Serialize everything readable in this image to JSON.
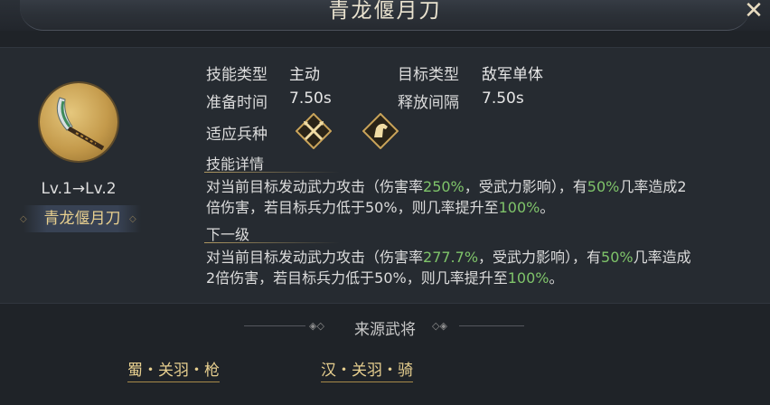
{
  "title": "青龙偃月刀",
  "close_icon": "close-icon",
  "skill": {
    "level_text": "Lv.1→Lv.2",
    "name": "青龙偃月刀",
    "icon": "glaive-icon"
  },
  "info": {
    "skill_type_label": "技能类型",
    "skill_type_value": "主动",
    "target_type_label": "目标类型",
    "target_type_value": "敌军单体",
    "prep_time_label": "准备时间",
    "prep_time_value": "7.50s",
    "cooldown_label": "释放间隔",
    "cooldown_value": "7.50s",
    "troop_label": "适应兵种",
    "troop_icons": [
      "spear-troop-icon",
      "cavalry-troop-icon"
    ]
  },
  "details": {
    "header": "技能详情",
    "current": {
      "p1": "对当前目标发动武力攻击（伤害率",
      "v1": "250%",
      "p2": "，受武力影响），有",
      "v2": "50%",
      "p3": "几率造成2",
      "line2_a": "倍伤害，若目标兵力低于50%，则几率提升至",
      "v3": "100%",
      "line2_b": "。"
    },
    "next_header": "下一级",
    "next": {
      "p1": "对当前目标发动武力攻击（伤害率",
      "v1": "277.7%",
      "p2": "，受武力影响），有",
      "v2": "50%",
      "p3": "几率造成",
      "line2_a": "2倍伤害，若目标兵力低于50%，则几率提升至",
      "v3": "100%",
      "line2_b": "。"
    }
  },
  "source": {
    "title": "来源武将",
    "generals": [
      "蜀・关羽・枪",
      "汉・关羽・骑"
    ]
  },
  "colors": {
    "highlight": "#7fc46a",
    "gold": "#e7cf8f"
  }
}
